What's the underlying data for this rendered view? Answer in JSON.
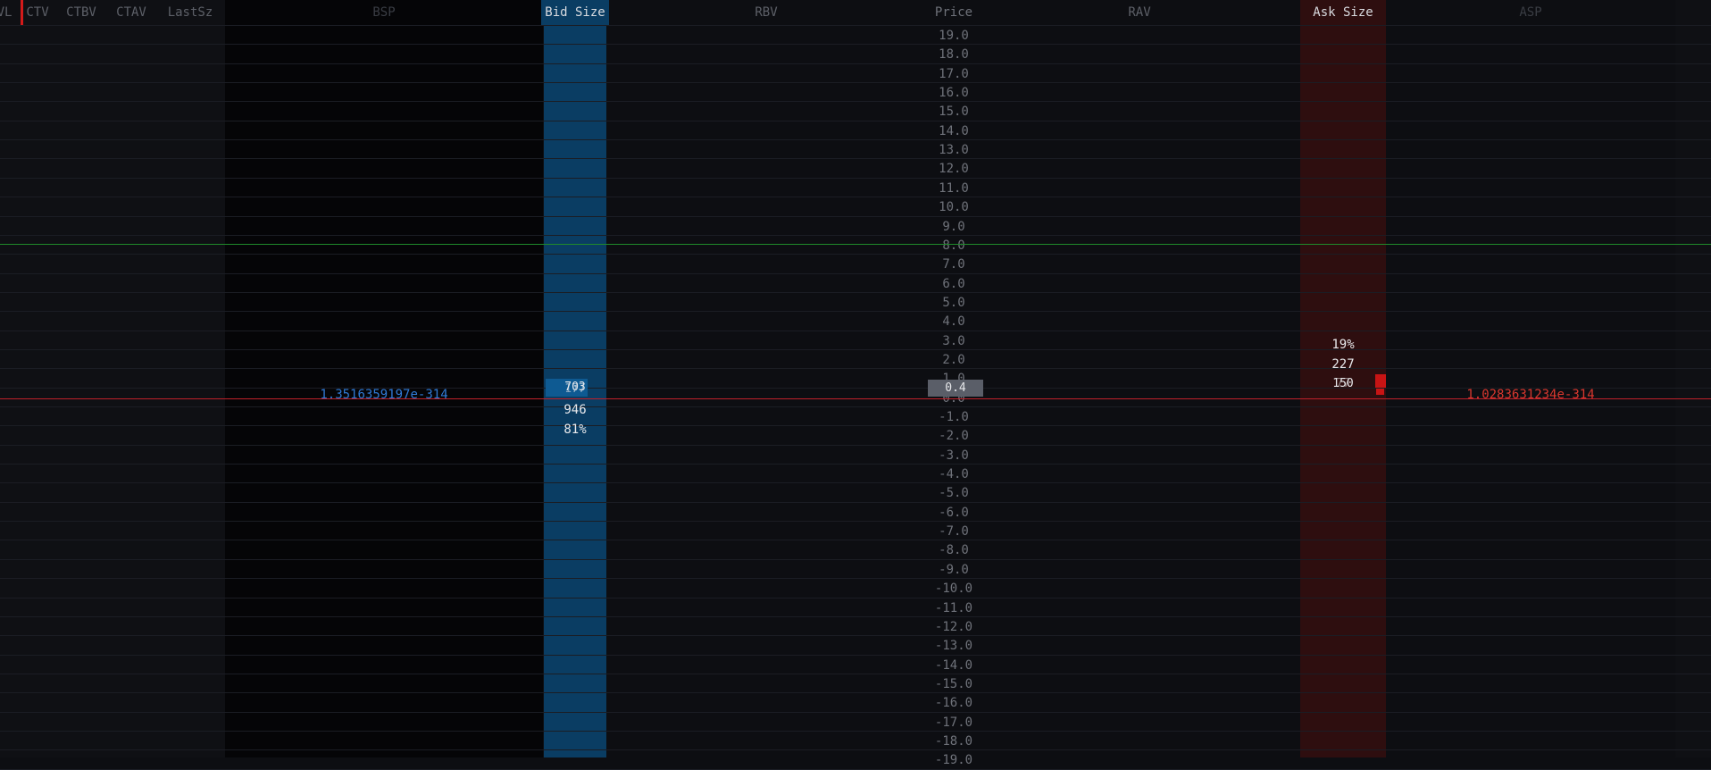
{
  "columns": {
    "vl": "VL",
    "ctv": "CTV",
    "ctbv": "CTBV",
    "ctav": "CTAV",
    "lastsz": "LastSz",
    "bsp": "BSP",
    "bid_size": "Bid Size",
    "rbv": "RBV",
    "price": "Price",
    "rav": "RAV",
    "ask_size": "Ask Size",
    "asp": "ASP"
  },
  "prices": [
    "19.0",
    "18.0",
    "17.0",
    "16.0",
    "15.0",
    "14.0",
    "13.0",
    "12.0",
    "11.0",
    "10.0",
    "9.0",
    "8.0",
    "7.0",
    "6.0",
    "5.0",
    "4.0",
    "3.0",
    "2.0",
    "1.0",
    "0.0",
    "-1.0",
    "-2.0",
    "-3.0",
    "-4.0",
    "-5.0",
    "-6.0",
    "-7.0",
    "-8.0",
    "-9.0",
    "-10.0",
    "-11.0",
    "-12.0",
    "-13.0",
    "-14.0",
    "-15.0",
    "-16.0",
    "-17.0",
    "-18.0",
    "-19.0"
  ],
  "current_price": "0.4",
  "bid": {
    "size_overlap_a": "703",
    "size_overlap_b": "177",
    "total": "946",
    "percent": "81%",
    "bsp_value": "1.3516359197e-314"
  },
  "ask": {
    "percent": "19%",
    "total": "227",
    "size_overlap_a": "150",
    "size_overlap_b": "77",
    "asp_value": "1.0283631234e-314"
  },
  "colors": {
    "background": "#0d0e12",
    "bid_band": "#0a3d63",
    "ask_band": "#2e0e0f",
    "bid_text": "#2f7ad6",
    "ask_text": "#d8372e",
    "green_line": "#1f8a2a",
    "red_line": "#c0202a"
  }
}
